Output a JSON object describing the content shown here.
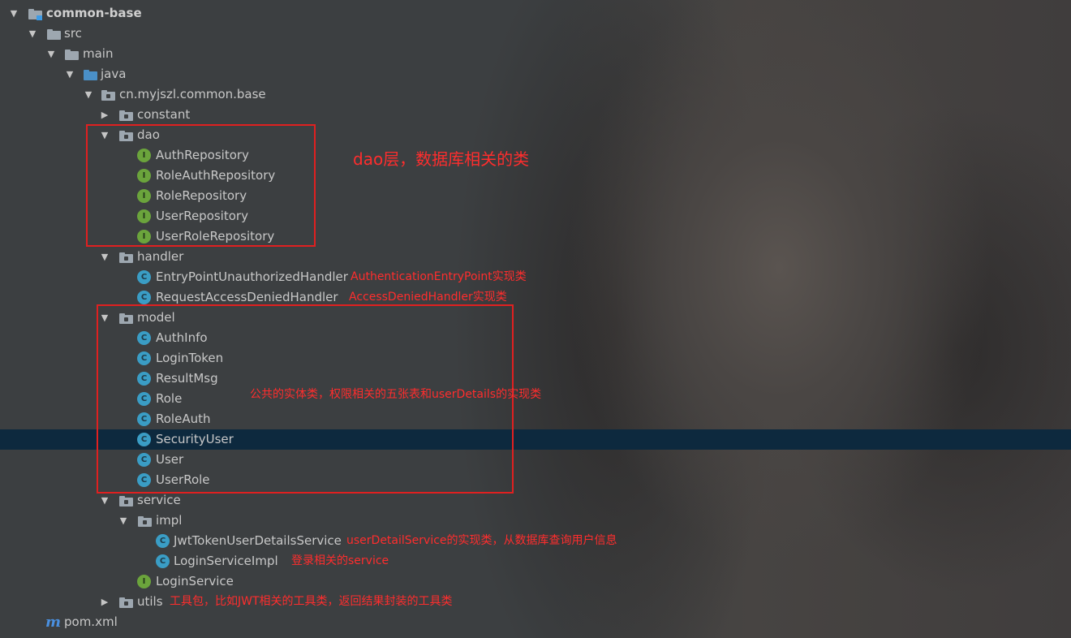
{
  "tree": [
    {
      "label": "common-base",
      "bold": true
    },
    {
      "label": "src"
    },
    {
      "label": "main"
    },
    {
      "label": "java"
    },
    {
      "label": "cn.myjszl.common.base"
    },
    {
      "label": "constant"
    },
    {
      "label": "dao"
    },
    {
      "label": "AuthRepository"
    },
    {
      "label": "RoleAuthRepository"
    },
    {
      "label": "RoleRepository"
    },
    {
      "label": "UserRepository"
    },
    {
      "label": "UserRoleRepository"
    },
    {
      "label": "handler"
    },
    {
      "label": "EntryPointUnauthorizedHandler"
    },
    {
      "label": "RequestAccessDeniedHandler"
    },
    {
      "label": "model"
    },
    {
      "label": "AuthInfo"
    },
    {
      "label": "LoginToken"
    },
    {
      "label": "ResultMsg"
    },
    {
      "label": "Role"
    },
    {
      "label": "RoleAuth"
    },
    {
      "label": "SecurityUser",
      "selected": true
    },
    {
      "label": "User"
    },
    {
      "label": "UserRole"
    },
    {
      "label": "service"
    },
    {
      "label": "impl"
    },
    {
      "label": "JwtTokenUserDetailsService"
    },
    {
      "label": "LoginServiceImpl"
    },
    {
      "label": "LoginService"
    },
    {
      "label": "utils"
    },
    {
      "label": "pom.xml"
    }
  ],
  "icons": {
    "class_letter": "C",
    "interface_letter": "I",
    "maven_letter": "m",
    "arrow_expanded": "▼",
    "arrow_collapsed": "▶"
  },
  "annotations": {
    "dao": "dao层，数据库相关的类",
    "entry_point": "AuthenticationEntryPoint实现类",
    "access_denied": "AccessDeniedHandler实现类",
    "model": "公共的实体类，权限相关的五张表和userDetails的实现类",
    "jwt_service": "userDetailService的实现类，从数据库查询用户信息",
    "login_impl": "登录相关的service",
    "utils": "工具包，比如JWT相关的工具类，返回结果封装的工具类"
  },
  "colors": {
    "annotation": "#ff2d2d",
    "selection": "#0d293e",
    "class_icon": "#3a9dc5",
    "interface_icon": "#6ba43c"
  }
}
